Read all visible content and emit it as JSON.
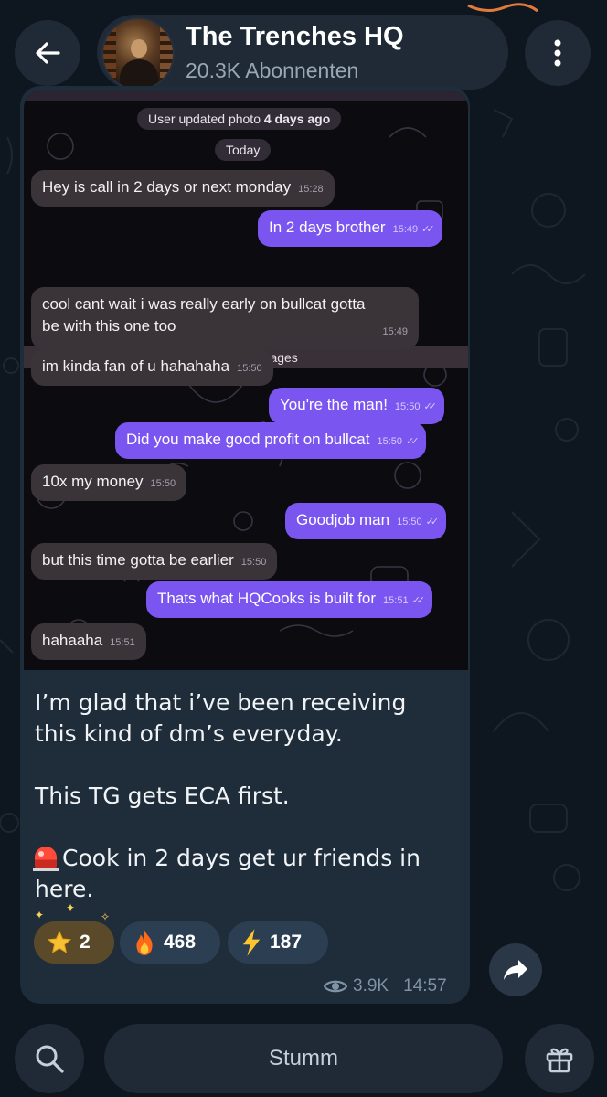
{
  "header": {
    "back_icon": "arrow-left-icon",
    "channel_name": "The Trenches HQ",
    "subscribers": "20.3K Abonnenten",
    "menu_icon": "more-vertical-icon"
  },
  "screenshot": {
    "system_line_prefix": "User updated photo",
    "system_line_bold": "4 days ago",
    "date_pill": "Today",
    "unread_label": "Unread Messages",
    "messages": [
      {
        "side": "in",
        "text": "Hey is call in 2 days or next monday",
        "time": "15:28"
      },
      {
        "side": "out",
        "text": "In 2 days brother",
        "time": "15:49"
      },
      {
        "side": "in",
        "text": "cool cant wait i was really early on bullcat gotta",
        "text2": "be with this one too",
        "time": "15:49"
      },
      {
        "side": "in",
        "text": "im kinda fan of u hahahaha",
        "time": "15:50"
      },
      {
        "side": "out",
        "text": "You're the man!",
        "time": "15:50"
      },
      {
        "side": "out",
        "text": "Did you make good profit on bullcat",
        "time": "15:50"
      },
      {
        "side": "in",
        "text": "10x my money",
        "time": "15:50"
      },
      {
        "side": "out",
        "text": "Goodjob man",
        "time": "15:50"
      },
      {
        "side": "in",
        "text": "but this time gotta be earlier",
        "time": "15:50"
      },
      {
        "side": "out",
        "text": "Thats what HQCooks is built for",
        "time": "15:51"
      },
      {
        "side": "in",
        "text": "hahaaha",
        "time": "15:51"
      }
    ]
  },
  "caption": {
    "line1": "I’m glad that i’ve been receiving",
    "line2": "this kind of dm’s everyday.",
    "line3": "This TG gets ECA first.",
    "line4": "Cook in 2 days get ur friends in",
    "line5": "here.",
    "emoji_icon": "rotating-light-icon"
  },
  "reactions": [
    {
      "icon": "star-icon",
      "count": "2"
    },
    {
      "icon": "fire-icon",
      "count": "468"
    },
    {
      "icon": "lightning-icon",
      "count": "187"
    }
  ],
  "post_meta": {
    "views": "3.9K",
    "time": "14:57"
  },
  "bottom_bar": {
    "search_icon": "search-icon",
    "mute_label": "Stumm",
    "gift_icon": "gift-icon"
  },
  "colors": {
    "background": "#0e1620",
    "card": "#1f2c39",
    "outgoing_bubble": "#7a55f0",
    "incoming_bubble": "#3a3338",
    "reaction_pill": "#2b3e52"
  }
}
